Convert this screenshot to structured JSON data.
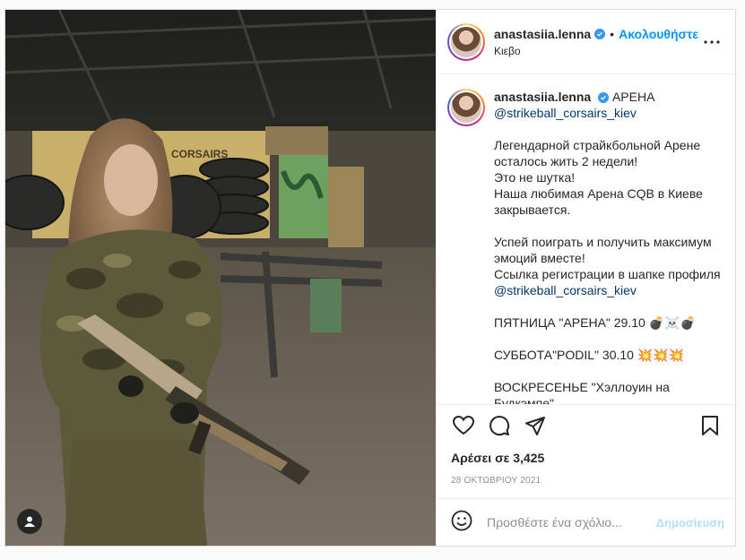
{
  "post": {
    "username": "anastasiia.lenna",
    "follow_label": "Ακολουθήστε",
    "separator": "•",
    "location": "Κιεβο",
    "caption_title": "АРЕНА",
    "caption_lines": [
      {
        "text": "@strikeball_corsairs_kiev",
        "mention": true
      },
      {
        "text": " ",
        "mention": false
      },
      {
        "text": "Легендарной страйкбольной Арене осталось жить 2 недели!",
        "mention": false
      },
      {
        "text": "Это не шутка!",
        "mention": false
      },
      {
        "text": "Наша любимая Арена CQB в Киеве закрывается.",
        "mention": false
      },
      {
        "text": " ",
        "mention": false
      },
      {
        "text": "Успей поиграть и получить максимум эмоций вместе!",
        "mention": false
      },
      {
        "text": "Ссылка регистрации в шапке профиля",
        "mention": false
      },
      {
        "text": "@strikeball_corsairs_kiev",
        "mention": true
      },
      {
        "text": " ",
        "mention": false
      },
      {
        "text": "ПЯТНИЦА \"АРЕНА\" 29.10 💣☠️💣",
        "mention": false
      },
      {
        "text": " ",
        "mention": false
      },
      {
        "text": "СУББОТА\"PODIL\" 30.10 💥💥💥",
        "mention": false
      },
      {
        "text": " ",
        "mention": false
      },
      {
        "text": "ВОСКРЕСЕНЬЕ \"Хэллоуин на Будкэмпе\"",
        "mention": false
      }
    ],
    "likes_label": "Αρέσει σε 3,425",
    "date": "28 ΟΚΤΩΒΡΙΟΥ 2021",
    "comment_placeholder": "Προσθέστε ένα σχόλιο...",
    "post_button": "Δημοσίευση"
  },
  "media": {
    "wall_sign": "CORSAIRS"
  },
  "icons": {
    "verified": "verified-badge-icon",
    "more": "more-options-icon",
    "like": "heart-icon",
    "comment": "comment-bubble-icon",
    "share": "paper-plane-icon",
    "save": "bookmark-icon",
    "emoji": "emoji-icon",
    "user_tag": "user-tag-icon"
  },
  "colors": {
    "link": "#0095f6",
    "mention": "#00376b",
    "verified": "#3897f0",
    "post_disabled": "#b2dffc"
  }
}
